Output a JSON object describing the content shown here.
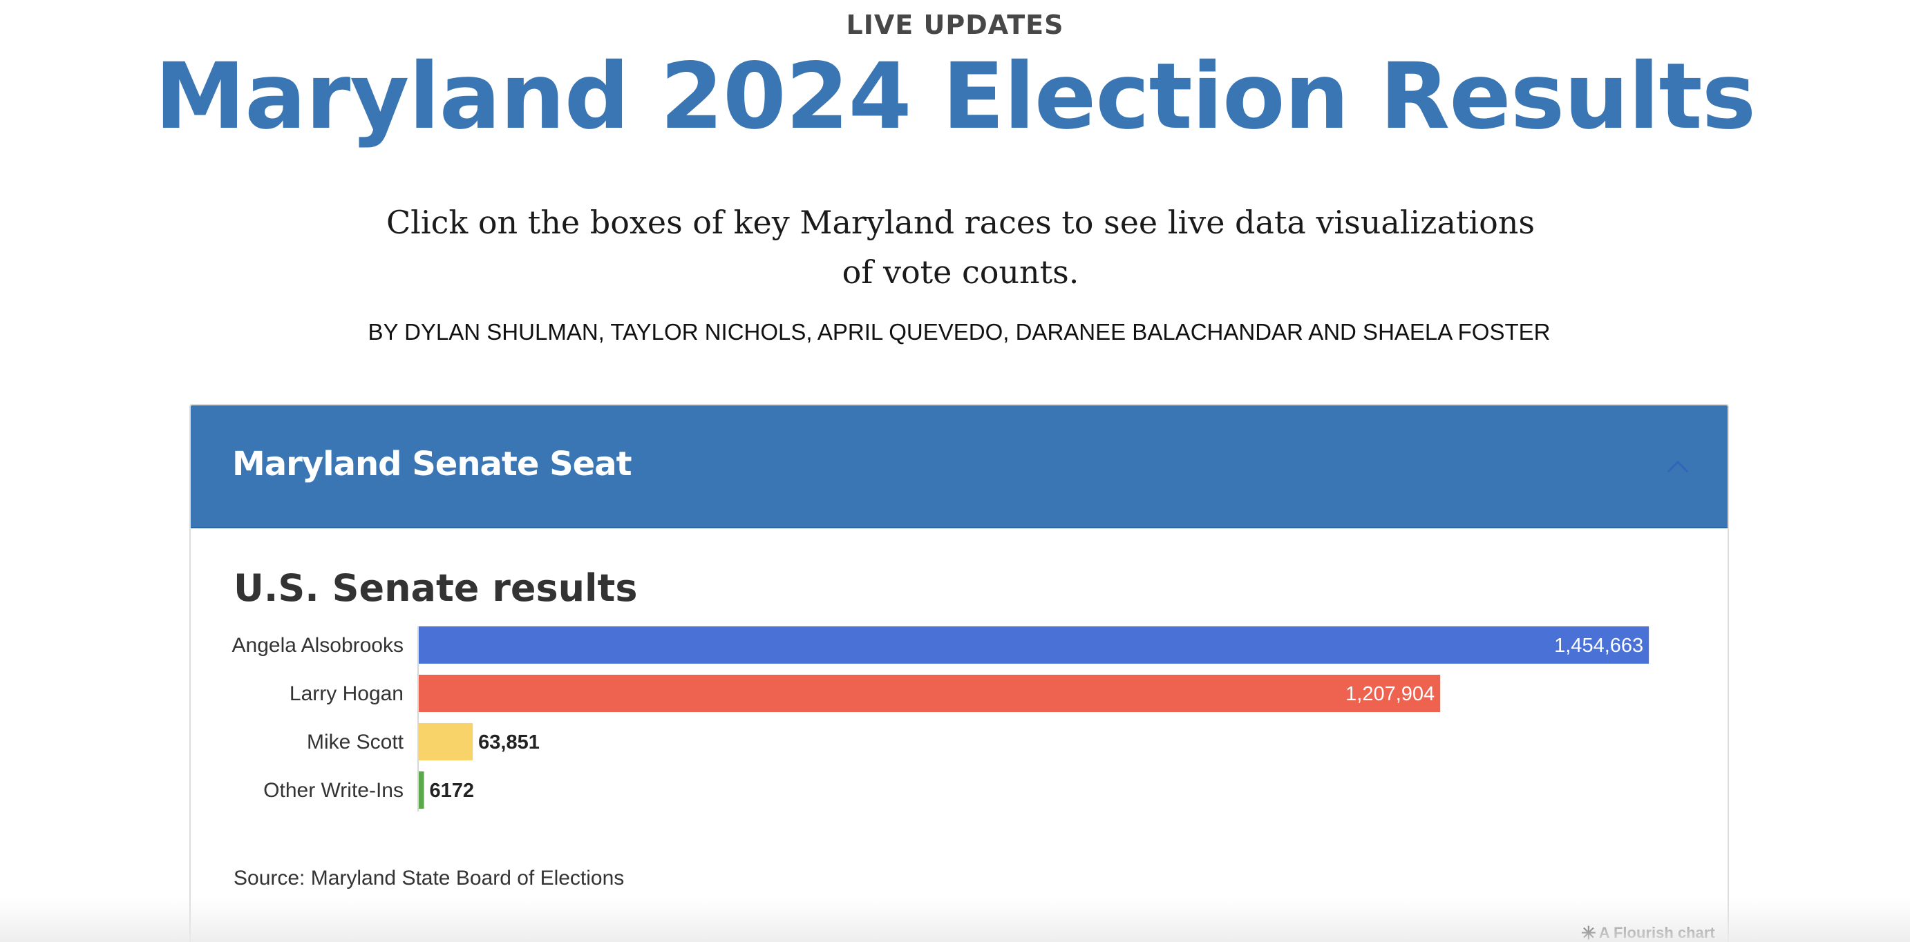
{
  "header": {
    "kicker": "LIVE UPDATES",
    "headline": "Maryland 2024 Election Results",
    "dek": "Click on the boxes of key Maryland races to see live data visualizations of vote counts.",
    "byline": "BY DYLAN SHULMAN, TAYLOR NICHOLS, APRIL QUEVEDO, DARANEE BALACHANDAR AND SHAELA FOSTER"
  },
  "panel": {
    "title": "Maryland Senate Seat",
    "toggle_icon": "chevron-up-icon",
    "header_color": "#3a76b3"
  },
  "chart_data": {
    "type": "bar",
    "orientation": "horizontal",
    "title": "U.S. Senate results",
    "categories": [
      "Angela Alsobrooks",
      "Larry Hogan",
      "Mike Scott",
      "Other Write-Ins"
    ],
    "values": [
      1454663,
      1207904,
      63851,
      6172
    ],
    "value_labels": [
      "1,454,663",
      "1,207,904",
      "63,851",
      "6172"
    ],
    "colors": [
      "#4a72d6",
      "#ee6350",
      "#f7d36a",
      "#5aa94a"
    ],
    "xlim": [
      0,
      1600000
    ],
    "grid": false,
    "source": "Source: Maryland State Board of Elections"
  },
  "footer": {
    "credit": "A Flourish chart",
    "credit_icon": "flourish-asterisk-icon"
  }
}
